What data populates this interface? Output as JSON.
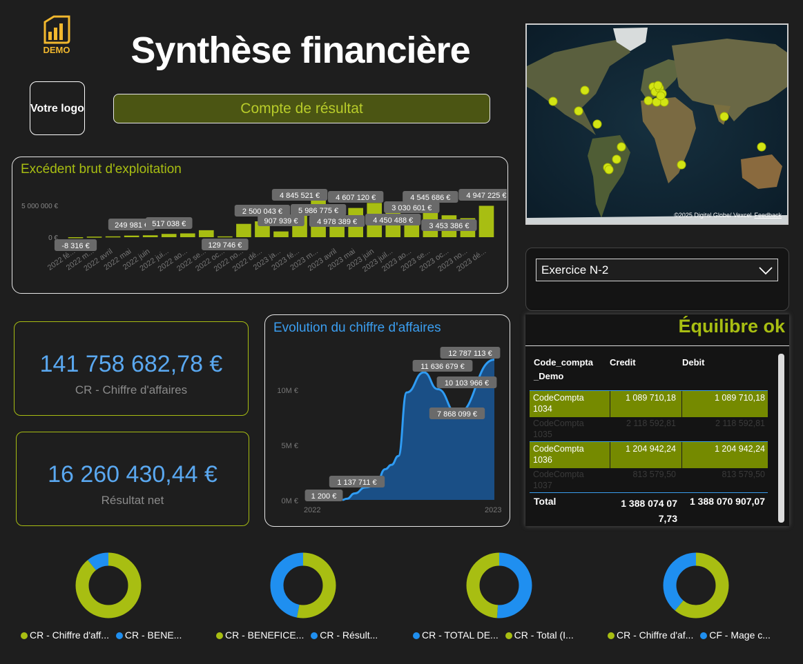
{
  "header": {
    "demo_label": "DEMO",
    "title": "Synthèse financière",
    "logo_text": "Votre logo",
    "button_label": "Compte de résultat"
  },
  "colors": {
    "accent": "#a8be12",
    "blue": "#3b9ef0",
    "background": "#1e1e1e"
  },
  "kpis": [
    {
      "value": "141 758 682,78 €",
      "label": "CR - Chiffre d'affaires"
    },
    {
      "value": "16 260 430,44 €",
      "label": "Résultat net"
    }
  ],
  "map": {
    "credit": "©2025 Digital Globe/ Vexcel",
    "feedback": "Feedback"
  },
  "slicer": {
    "value": "Exercice N-2",
    "icon": "chevron-down-icon"
  },
  "balance_table": {
    "title": "Équilibre ok",
    "headers": [
      "Code_compta _Demo",
      "Credit",
      "Debit"
    ],
    "rows": [
      {
        "code": "CodeCompta 1034",
        "credit": "1 089 710,18",
        "debit": "1 089 710,18"
      },
      {
        "code": "CodeCompta 1035",
        "credit": "2 118 592,81",
        "debit": "2 118 592,81"
      },
      {
        "code": "CodeCompta 1036",
        "credit": "1 204 942,24",
        "debit": "1 204 942,24"
      },
      {
        "code": "CodeCompta 1037",
        "credit": "813 579,50",
        "debit": "813 579,50"
      }
    ],
    "total": {
      "label": "Total",
      "credit": "1 388 074 07 7,73",
      "debit": "1 388 070 907,07"
    }
  },
  "chart_data": [
    {
      "type": "bar",
      "title": "Excédent brut d'exploitation",
      "ytick_labels": [
        "5 000 000 €",
        "0 €"
      ],
      "categories": [
        "2022 fé...",
        "2022 m...",
        "2022 avril",
        "2022 mai",
        "2022 juin",
        "2022 jui...",
        "2022 ao...",
        "2022 se...",
        "2022 oc...",
        "2022 no...",
        "2022 dé...",
        "2023 ja...",
        "2023 fé...",
        "2023 m...",
        "2023 avril",
        "2023 mai",
        "2023 juin",
        "2023 juil...",
        "2023 ao...",
        "2023 se...",
        "2023 oc...",
        "2023 no...",
        "2023 dé..."
      ],
      "values": [
        -8316,
        90000,
        130000,
        249981,
        300000,
        517038,
        600000,
        1100000,
        129746,
        2100000,
        2500043,
        907939,
        4845521,
        5986775,
        4978389,
        4607120,
        5400000,
        4450488,
        3030601,
        4545686,
        3453386,
        3000000,
        4947225
      ],
      "data_labels": [
        "-8 316 €",
        "",
        "",
        "249 981 €",
        "",
        "517 038 €",
        "",
        "",
        "129 746 €",
        "",
        "2 500 043 €",
        "907 939 €",
        "4 845 521 €",
        "5 986 775 €",
        "4 978 389 €",
        "4 607 120 €",
        "",
        "4 450 488 €",
        "3 030 601 €",
        "4 545 686 €",
        "3 453 386 €",
        "",
        "4 947 225 €"
      ]
    },
    {
      "type": "area",
      "title": "Evolution du chiffre d'affaires",
      "ytick_labels": [
        "10M €",
        "5M €",
        "0M €"
      ],
      "xtick_labels": [
        "2022",
        "2023"
      ],
      "values": [
        1200,
        100000,
        600000,
        1137711,
        1300000,
        2800000,
        3200000,
        4000000,
        9800000,
        11636679,
        10103966,
        7868099,
        12787113
      ],
      "data_labels": [
        "1 200 €",
        "1 137 711 €",
        "11 636 679 €",
        "10 103 966 €",
        "7 868 099 €",
        "12 787 113 €"
      ]
    },
    {
      "type": "pie",
      "series": [
        {
          "legend": "CR - Chiffre d'aff...",
          "value": 89,
          "color": "#a8be12"
        },
        {
          "legend": "CR - BENE...",
          "value": 11,
          "color": "#1f8ff0"
        }
      ]
    },
    {
      "type": "pie",
      "series": [
        {
          "legend": "CR - BENEFICE...",
          "value": 53,
          "color": "#a8be12"
        },
        {
          "legend": "CR - Résult...",
          "value": 47,
          "color": "#1f8ff0"
        }
      ]
    },
    {
      "type": "pie",
      "series": [
        {
          "legend": "CR - TOTAL DE...",
          "value": 51,
          "color": "#1f8ff0"
        },
        {
          "legend": "CR - Total (I...",
          "value": 49,
          "color": "#a8be12"
        }
      ]
    },
    {
      "type": "pie",
      "series": [
        {
          "legend": "CR - Chiffre d'af...",
          "value": 61,
          "color": "#a8be12"
        },
        {
          "legend": "CF - Mage c...",
          "value": 39,
          "color": "#1f8ff0"
        }
      ]
    }
  ]
}
